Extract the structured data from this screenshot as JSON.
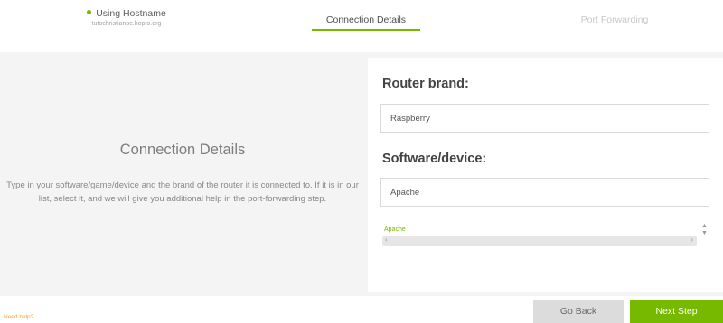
{
  "steps": [
    {
      "title": "Using Hostname",
      "subtitle": "tutochristianpc.hopto.org"
    },
    {
      "title": "Connection Details"
    },
    {
      "title": "Port Forwarding"
    }
  ],
  "left": {
    "title": "Connection Details",
    "description": "Type in your software/game/device and the brand of the router it is connected to. If it is in our list, select it, and we will give you additional help in the port-forwarding step."
  },
  "form": {
    "router_label": "Router brand:",
    "router_value": "Raspberry",
    "software_label": "Software/device:",
    "software_value": "Apache",
    "suggestions": [
      "Apache"
    ]
  },
  "footer": {
    "help_link": "Need help?",
    "back_label": "Go Back",
    "next_label": "Next Step"
  },
  "colors": {
    "accent": "#76b900",
    "help": "#f0a33a"
  }
}
